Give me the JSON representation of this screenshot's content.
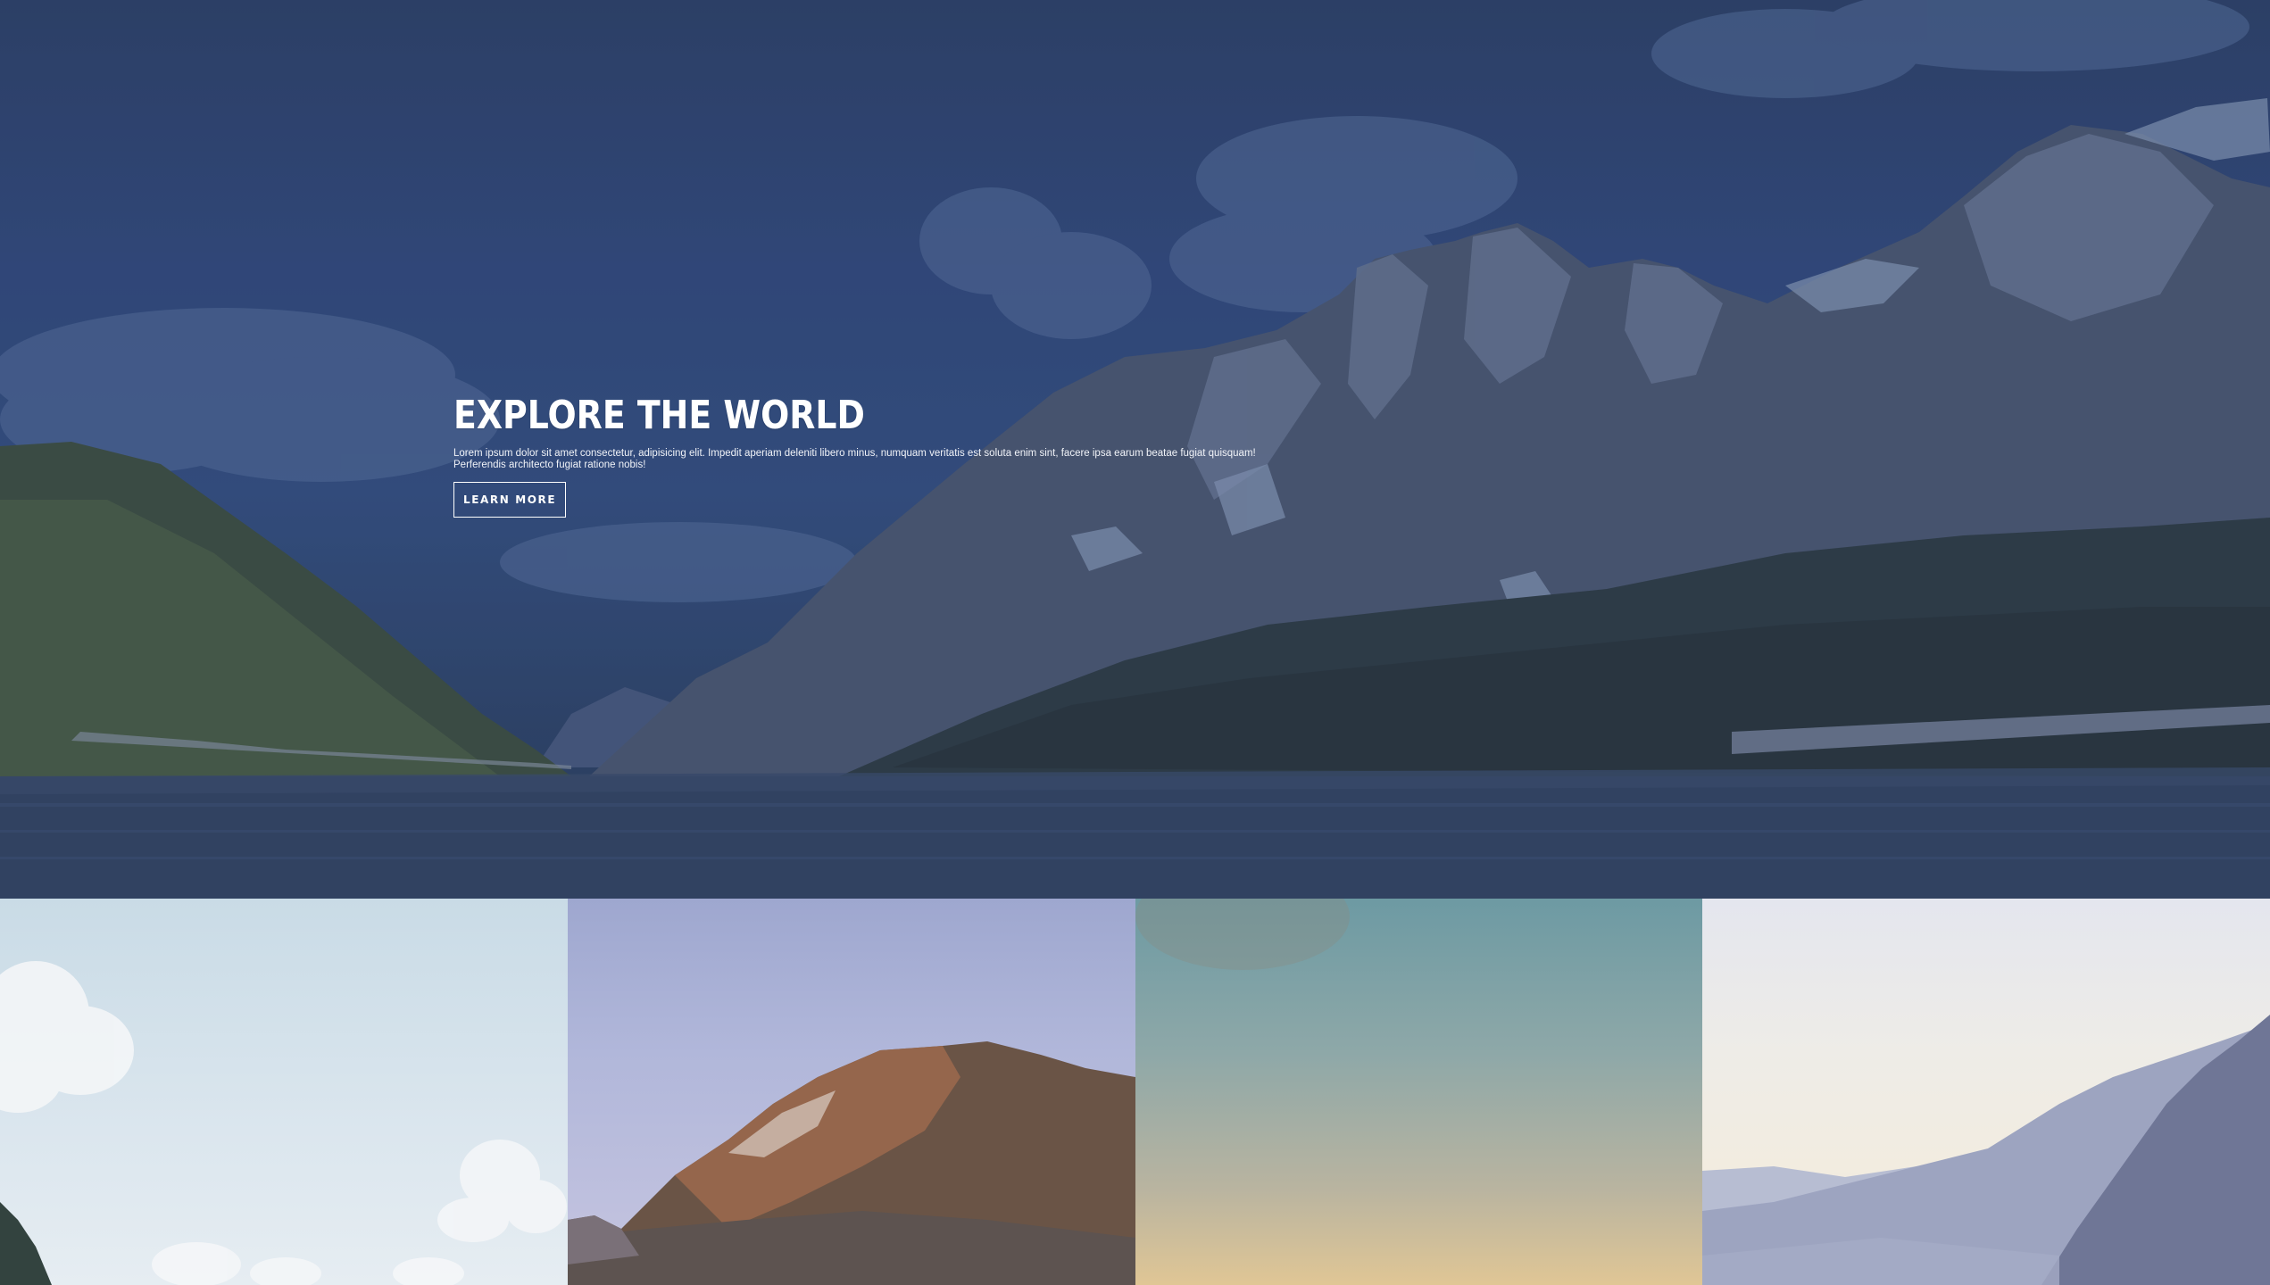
{
  "hero": {
    "title": "EXPLORE THE WORLD",
    "text": "Lorem ipsum dolor sit amet consectetur, adipisicing elit. Impedit aperiam deleniti libero minus, numquam veritatis est soluta enim sint, facere ipsa earum beatae fugiat quisquam! Perferendis architecto fugiat ratione nobis!",
    "button_label": "LEARN MORE"
  },
  "colors": {
    "hero_sky": "#32497a",
    "button_border": "#ffffff",
    "title": "#ffffff"
  },
  "gallery": {
    "tiles": [
      {
        "subject": "sky-clouds-cliff"
      },
      {
        "subject": "sunlit-mountain-peak"
      },
      {
        "subject": "dusk-gradient-sky"
      },
      {
        "subject": "misty-mountain-ridges"
      }
    ]
  }
}
